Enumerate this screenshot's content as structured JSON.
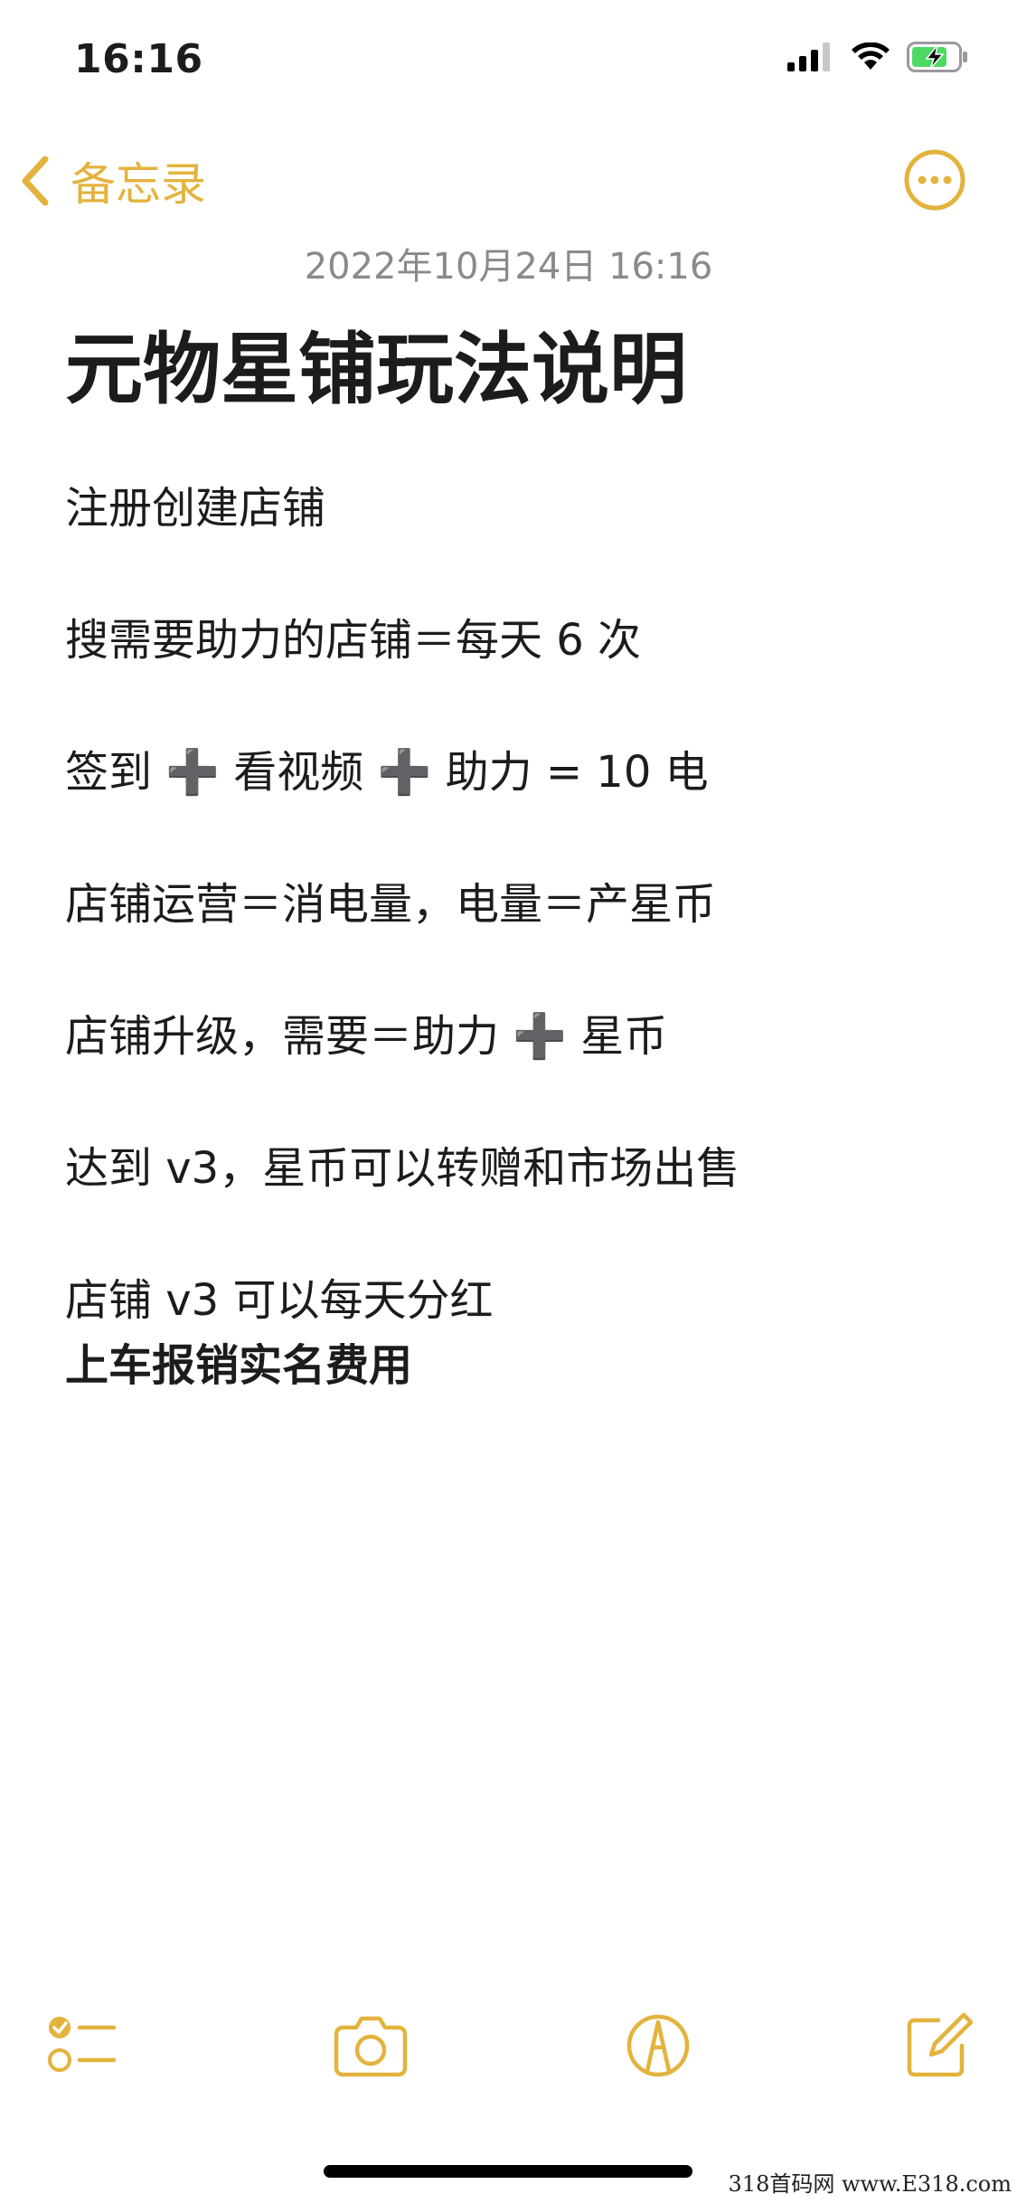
{
  "status_bar": {
    "time": "16:16",
    "icons": [
      "signal-icon",
      "wifi-icon",
      "battery-charging-icon"
    ]
  },
  "nav": {
    "back_label": "备忘录",
    "back_icon": "chevron-left-icon",
    "more_icon": "ellipsis-circle-icon"
  },
  "note": {
    "timestamp": "2022年10月24日 16:16",
    "title": "元物星铺玩法说明",
    "paragraphs": [
      "注册创建店铺",
      "搜需要助力的店铺＝每天 6 次",
      "签到 ➕ 看视频 ➕ 助力 = 10 电",
      "店铺运营＝消电量，电量＝产星币",
      "店铺升级，需要＝助力 ➕ 星币",
      "达到 v3，星币可以转赠和市场出售",
      "店铺 v3 可以每天分红",
      "上车报销实名费用"
    ]
  },
  "toolbar": {
    "icons": [
      "checklist-icon",
      "camera-icon",
      "markup-pen-icon",
      "compose-icon"
    ]
  },
  "watermark": "318首码网  www.E318.com",
  "colors": {
    "accent": "#E3B33D",
    "text": "#1c1c1e",
    "timestamp": "#8a8a8e",
    "background": "#ffffff"
  }
}
